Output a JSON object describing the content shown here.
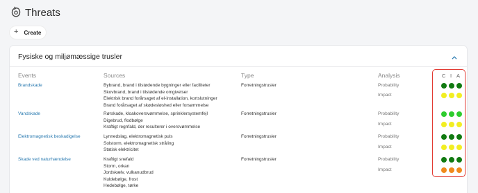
{
  "page": {
    "title": "Threats"
  },
  "toolbar": {
    "create_label": "Create"
  },
  "card": {
    "title": "Fysiske og miljømæssige trusler",
    "columns": {
      "events": "Events",
      "sources": "Sources",
      "type": "Type",
      "analysis": "Analysis",
      "c": "C",
      "i": "I",
      "a": "A"
    },
    "rows": [
      {
        "event": "Brandskade",
        "sources": [
          "Bybrand, brand i tilstødende bygninger eller faciliteter",
          "Skovbrand, brand i tilstødende omgivelser",
          "Elektrisk brand forårsaget af el-installation, kortslutninger",
          "Brand forårsaget af skødesløshed eller forsømmelse"
        ],
        "type": "Forretningstrusler",
        "probability_label": "Probability",
        "impact_label": "Impact",
        "probability_colors": [
          "#117a11",
          "#117a11",
          "#117a11"
        ],
        "impact_colors": [
          "#f2ee22",
          "#f2ee22",
          "#f2ee22"
        ]
      },
      {
        "event": "Vandskade",
        "sources": [
          "Rørskade, kloakoversvømmelse, sprinklersystemfejl",
          "Digebrud, flodbølge",
          "Kraftigt regnfald, der resulterer i oversvømmelse"
        ],
        "type": "Forretningstrusler",
        "probability_label": "Probability",
        "impact_label": "Impact",
        "probability_colors": [
          "#2ecc2e",
          "#2ecc2e",
          "#2ecc2e"
        ],
        "impact_colors": [
          "#f2ee22",
          "#f2ee22",
          "#f2ee22"
        ]
      },
      {
        "event": "Elektromagnetisk beskadigelse",
        "sources": [
          "Lynnedslag, elektromagnetisk puls",
          "Solstorm, elektromagnetisk stråling",
          "Statisk elektricitet"
        ],
        "type": "Forretningstrusler",
        "probability_label": "Probability",
        "impact_label": "Impact",
        "probability_colors": [
          "#117a11",
          "#117a11",
          "#117a11"
        ],
        "impact_colors": [
          "#f2ee22",
          "#f2ee22",
          "#f2ee22"
        ]
      },
      {
        "event": "Skade ved naturhændelse",
        "sources": [
          "Kraftigt snefald",
          "Storm, orkan",
          "Jordskælv, vulkanudbrud",
          "Kuldebølge, frost",
          "Hedebølge, tørke"
        ],
        "type": "Forretningstrusler",
        "probability_label": "Probability",
        "impact_label": "Impact",
        "probability_colors": [
          "#117a11",
          "#117a11",
          "#117a11"
        ],
        "impact_colors": [
          "#f08a1c",
          "#f08a1c",
          "#f08a1c"
        ]
      }
    ]
  }
}
